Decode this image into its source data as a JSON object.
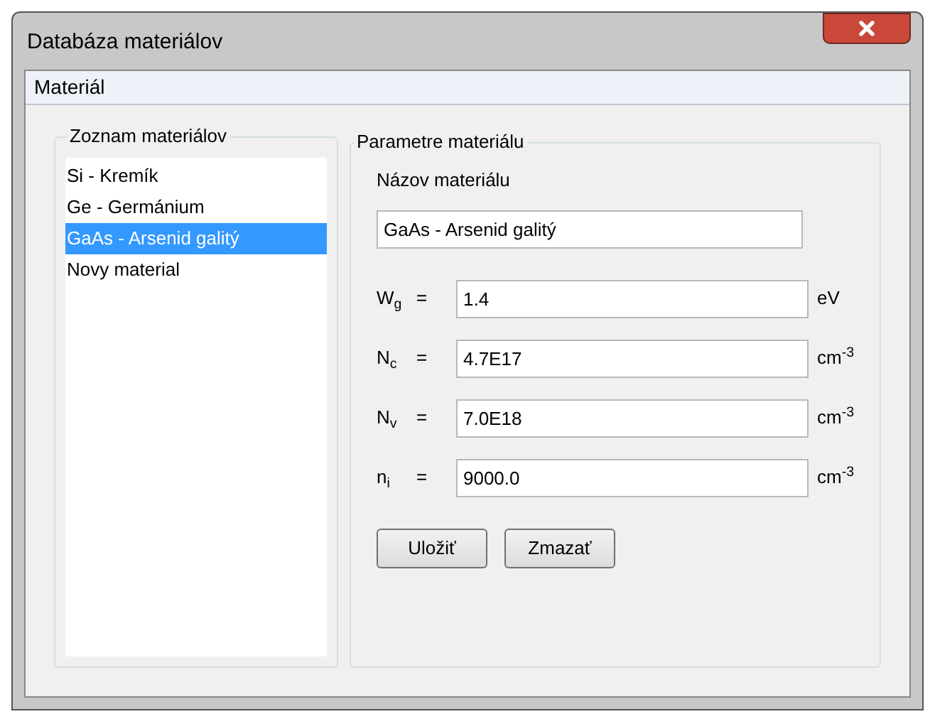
{
  "window": {
    "title": "Databáza materiálov"
  },
  "menu": [
    "Materiál"
  ],
  "materials": {
    "title": "Zoznam materiálov",
    "items": [
      {
        "label": "Si - Kremík",
        "selected": false
      },
      {
        "label": "Ge - Germánium",
        "selected": false
      },
      {
        "label": "GaAs - Arsenid galitý",
        "selected": true
      },
      {
        "label": "Novy material",
        "selected": false
      }
    ]
  },
  "parameters": {
    "title": "Parametre materiálu",
    "name_label": "Názov materiálu",
    "name_value": "GaAs - Arsenid galitý",
    "rows": [
      {
        "symbol": "W$_{g}$",
        "equals": "=",
        "value": "1.4",
        "unit": "eV"
      },
      {
        "symbol": "N$_{c}$",
        "equals": "=",
        "value": "4.7E17",
        "unit": "cm$^{-3}$"
      },
      {
        "symbol": "N$_{v}$",
        "equals": "=",
        "value": "7.0E18",
        "unit": "cm$^{-3}$"
      },
      {
        "symbol": "n$_{i}$",
        "equals": "=",
        "value": "9000.0",
        "unit": "cm$^{-3}$"
      }
    ],
    "buttons": [
      "Uložiť",
      "Zmazať"
    ]
  }
}
